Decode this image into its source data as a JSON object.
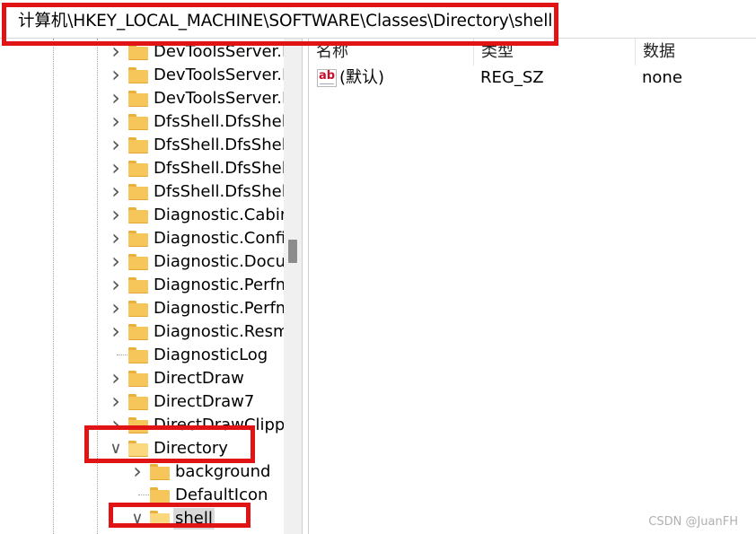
{
  "address": {
    "path": "计算机\\HKEY_LOCAL_MACHINE\\SOFTWARE\\Classes\\Directory\\shell"
  },
  "tree": {
    "items": [
      {
        "label": "DevToolsServer.N",
        "expander": "collapsed",
        "level": 0
      },
      {
        "label": "DevToolsServer.N",
        "expander": "collapsed",
        "level": 0
      },
      {
        "label": "DevToolsServer.N",
        "expander": "collapsed",
        "level": 0
      },
      {
        "label": "DfsShell.DfsShell",
        "expander": "collapsed",
        "level": 0
      },
      {
        "label": "DfsShell.DfsShell",
        "expander": "collapsed",
        "level": 0
      },
      {
        "label": "DfsShell.DfsShell",
        "expander": "collapsed",
        "level": 0
      },
      {
        "label": "DfsShell.DfsShell",
        "expander": "collapsed",
        "level": 0
      },
      {
        "label": "Diagnostic.Cabir",
        "expander": "collapsed",
        "level": 0
      },
      {
        "label": "Diagnostic.Confi",
        "expander": "collapsed",
        "level": 0
      },
      {
        "label": "Diagnostic.Docu",
        "expander": "collapsed",
        "level": 0
      },
      {
        "label": "Diagnostic.Perfm",
        "expander": "collapsed",
        "level": 0
      },
      {
        "label": "Diagnostic.Perfm",
        "expander": "collapsed",
        "level": 0
      },
      {
        "label": "Diagnostic.Resm",
        "expander": "collapsed",
        "level": 0
      },
      {
        "label": "DiagnosticLog",
        "expander": "none",
        "level": 0
      },
      {
        "label": "DirectDraw",
        "expander": "collapsed",
        "level": 0
      },
      {
        "label": "DirectDraw7",
        "expander": "collapsed",
        "level": 0
      },
      {
        "label": "DirectDrawClipp",
        "expander": "collapsed",
        "level": 0
      },
      {
        "label": "Directory",
        "expander": "expanded",
        "level": 0
      },
      {
        "label": "background",
        "expander": "collapsed",
        "level": 1
      },
      {
        "label": "DefaultIcon",
        "expander": "none",
        "level": 1
      },
      {
        "label": "shell",
        "expander": "expanded",
        "level": 1,
        "selected": true
      }
    ]
  },
  "list": {
    "columns": [
      "名称",
      "类型",
      "数据"
    ],
    "rows": [
      {
        "icon": "string-value-icon",
        "name": "(默认)",
        "type": "REG_SZ",
        "data": "none"
      }
    ]
  },
  "icons": {
    "string_value": "ab"
  },
  "watermark": "CSDN @JuanFH",
  "colors": {
    "highlight": "#e01414",
    "folder": "#f7c65b",
    "selection": "#d9d9d9"
  }
}
